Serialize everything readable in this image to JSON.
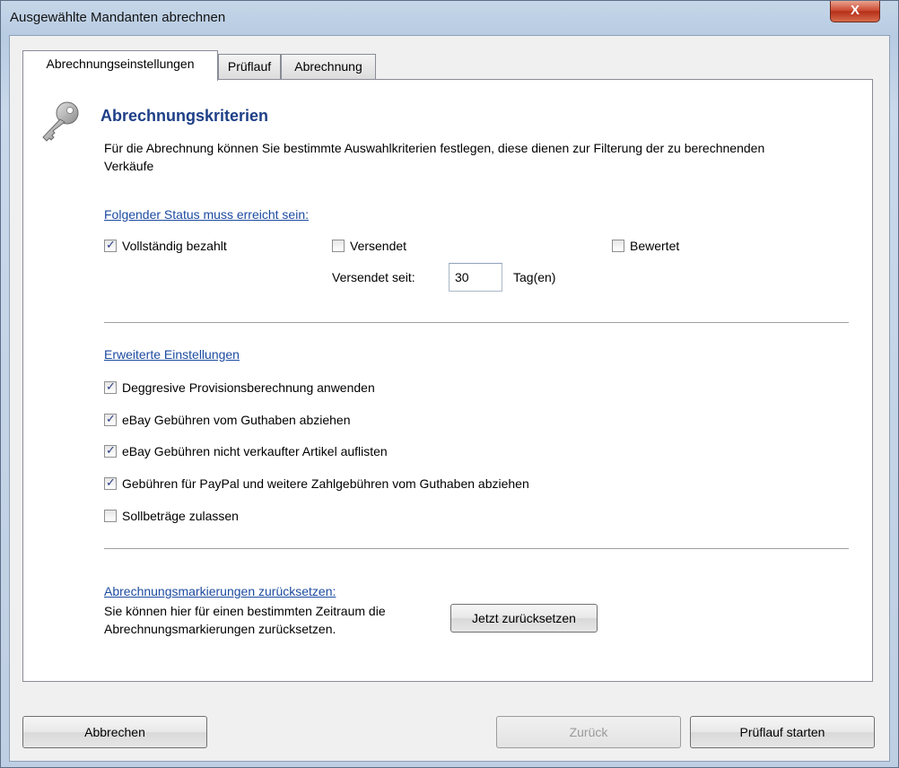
{
  "window": {
    "title": "Ausgewählte Mandanten abrechnen",
    "close_label": "X"
  },
  "tabs": [
    {
      "label": "Abrechnungseinstellungen",
      "active": true
    },
    {
      "label": "Prüflauf",
      "active": false
    },
    {
      "label": "Abrechnung",
      "active": false
    }
  ],
  "panel": {
    "icon": "key-icon",
    "heading": "Abrechnungskriterien",
    "description": "Für die Abrechnung können Sie bestimmte Auswahlkriterien festlegen, diese dienen zur Filterung der zu berechnenden Verkäufe",
    "status_section": {
      "title": "Folgender Status muss erreicht sein:",
      "checkboxes": [
        {
          "label": "Vollständig bezahlt",
          "checked": true
        },
        {
          "label": "Versendet",
          "checked": false
        },
        {
          "label": "Bewertet",
          "checked": false
        }
      ],
      "shipped_since_label": "Versendet seit:",
      "shipped_since_value": "30",
      "shipped_since_unit": "Tag(en)"
    },
    "advanced_section": {
      "title": "Erweiterte Einstellungen",
      "checkboxes": [
        {
          "label": "Deggresive Provisionsberechnung anwenden",
          "checked": true
        },
        {
          "label": "eBay Gebühren vom Guthaben abziehen",
          "checked": true
        },
        {
          "label": "eBay Gebühren nicht verkaufter Artikel auflisten",
          "checked": true
        },
        {
          "label": "Gebühren für PayPal und weitere Zahlgebühren vom Guthaben abziehen",
          "checked": true
        },
        {
          "label": "Sollbeträge zulassen",
          "checked": false
        }
      ]
    },
    "reset_section": {
      "title": "Abrechnungsmarkierungen zurücksetzen:",
      "text_line1": "Sie können hier für einen bestimmten Zeitraum die",
      "text_line2": "Abrechnungsmarkierungen zurücksetzen.",
      "button_label": "Jetzt zurücksetzen"
    }
  },
  "footer": {
    "cancel_label": "Abbrechen",
    "back_label": "Zurück",
    "next_label": "Prüflauf starten"
  }
}
